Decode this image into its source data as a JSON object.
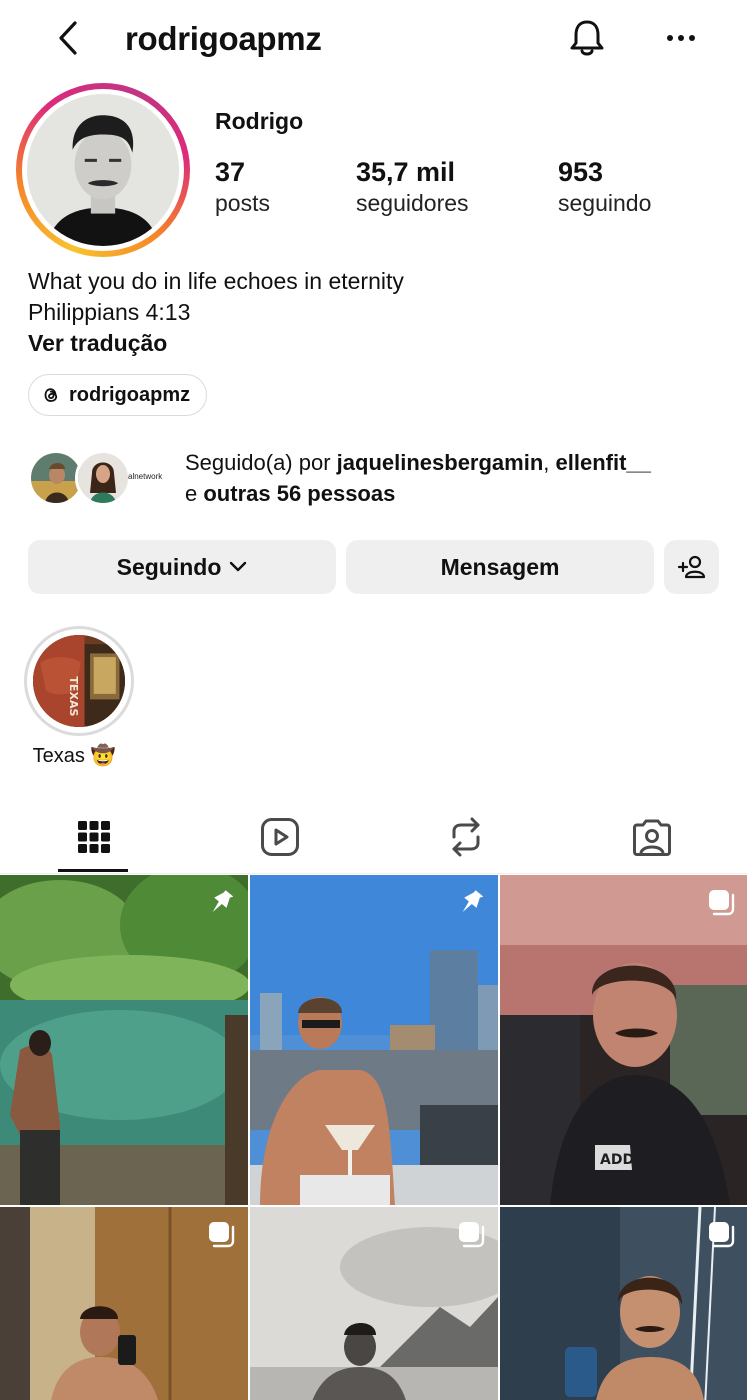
{
  "header": {
    "username": "rodrigoapmz"
  },
  "profile": {
    "display_name": "Rodrigo",
    "stats": [
      {
        "value": "37",
        "label": "posts"
      },
      {
        "value": "35,7 mil",
        "label": "seguidores"
      },
      {
        "value": "953",
        "label": "seguindo"
      }
    ],
    "bio_line1": "What you do in life echoes in eternity",
    "bio_line2": "Philippians 4:13",
    "translate_label": "Ver tradução",
    "threads_handle": "rodrigoapmz",
    "mini_avatar_caption": "alnetwork"
  },
  "followed_by": {
    "prefix": "Seguido(a) por ",
    "user1": "jaquelinesbergamin",
    "sep": ", ",
    "user2": "ellenfit__",
    "conj": "e ",
    "others": "outras 56 pessoas"
  },
  "actions": {
    "following_label": "Seguindo",
    "message_label": "Mensagem"
  },
  "highlights": [
    {
      "label": "Texas 🤠",
      "image_text": "TEXAS"
    }
  ],
  "tabs": [
    {
      "name": "grid",
      "icon": "grid-icon",
      "active": true
    },
    {
      "name": "reels",
      "icon": "reels-icon",
      "active": false
    },
    {
      "name": "reposts",
      "icon": "repost-icon",
      "active": false
    },
    {
      "name": "tagged",
      "icon": "tagged-icon",
      "active": false
    }
  ],
  "posts": [
    {
      "badge": "pin-icon",
      "image_text": ""
    },
    {
      "badge": "pin-icon",
      "image_text": ""
    },
    {
      "badge": "carousel-icon",
      "image_text": "ADDB"
    },
    {
      "badge": "carousel-icon",
      "image_text": ""
    },
    {
      "badge": "carousel-icon",
      "image_text": ""
    },
    {
      "badge": "carousel-icon",
      "image_text": ""
    }
  ],
  "colors": {
    "button_bg": "#efefef",
    "ring_gradient_start": "#f7c32e",
    "ring_gradient_end": "#c13584",
    "text": "#111111"
  }
}
